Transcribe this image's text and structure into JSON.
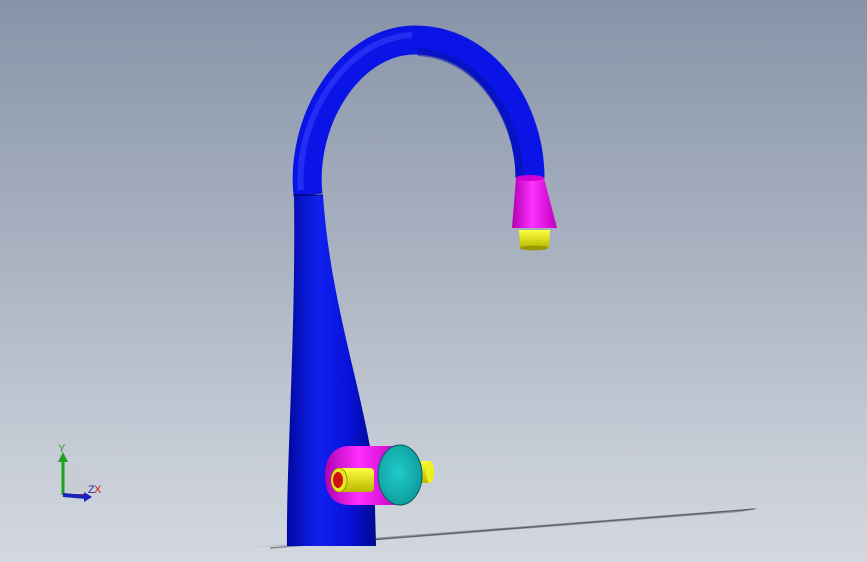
{
  "viewport": {
    "background_top": "#8794a8",
    "background_bottom": "#d3d8e0"
  },
  "model": {
    "colors": {
      "body": "#0a14e6",
      "accent": "#e010e0",
      "cap": "#18b8b8",
      "nozzle": "#e6e600",
      "inner": "#d01010"
    },
    "shadow": "floor-shadow"
  },
  "triad": {
    "y_label": "Y",
    "z_label": "Z",
    "x_label": "X"
  }
}
